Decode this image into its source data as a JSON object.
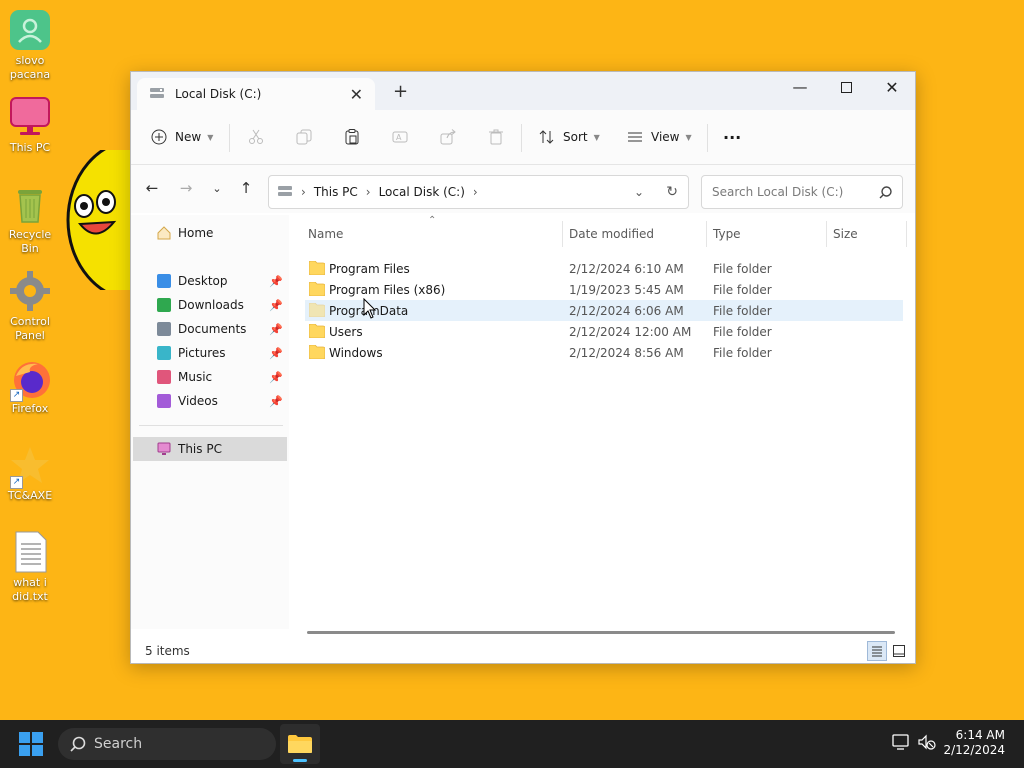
{
  "desktop": {
    "icons": [
      {
        "label": "slovo pacana"
      },
      {
        "label": "This PC"
      },
      {
        "label": "Recycle Bin"
      },
      {
        "label": "Control Panel"
      },
      {
        "label": "Firefox"
      },
      {
        "label": "TC&AXE"
      },
      {
        "label": "what i did.txt"
      }
    ]
  },
  "window": {
    "tab_title": "Local Disk (C:)",
    "toolbar": {
      "new_label": "New",
      "sort_label": "Sort",
      "view_label": "View",
      "more_label": "···"
    },
    "address": {
      "crumbs": [
        "This PC",
        "Local Disk (C:)"
      ]
    },
    "search": {
      "placeholder": "Search Local Disk (C:)"
    },
    "sidebar": {
      "home": "Home",
      "quick": [
        {
          "label": "Desktop",
          "color": "#3a8ee6"
        },
        {
          "label": "Downloads",
          "color": "#2fa84f"
        },
        {
          "label": "Documents",
          "color": "#7d8a99"
        },
        {
          "label": "Pictures",
          "color": "#39b5c9"
        },
        {
          "label": "Music",
          "color": "#e0567b"
        },
        {
          "label": "Videos",
          "color": "#a35bd8"
        }
      ],
      "this_pc": "This PC"
    },
    "columns": {
      "name": "Name",
      "date": "Date modified",
      "type": "Type",
      "size": "Size"
    },
    "files": [
      {
        "name": "Program Files",
        "date": "2/12/2024 6:10 AM",
        "type": "File folder"
      },
      {
        "name": "Program Files (x86)",
        "date": "1/19/2023 5:45 AM",
        "type": "File folder"
      },
      {
        "name": "ProgramData",
        "date": "2/12/2024 6:06 AM",
        "type": "File folder"
      },
      {
        "name": "Users",
        "date": "2/12/2024 12:00 AM",
        "type": "File folder"
      },
      {
        "name": "Windows",
        "date": "2/12/2024 8:56 AM",
        "type": "File folder"
      }
    ],
    "status": {
      "count": "5 items"
    }
  },
  "taskbar": {
    "search_label": "Search",
    "time": "6:14 AM",
    "date": "2/12/2024"
  },
  "colors": {
    "desktop_bg": "#FDB515",
    "folder": "#FFD75E",
    "selection": "#e5f1fb",
    "accent": "#4cc2ff"
  }
}
